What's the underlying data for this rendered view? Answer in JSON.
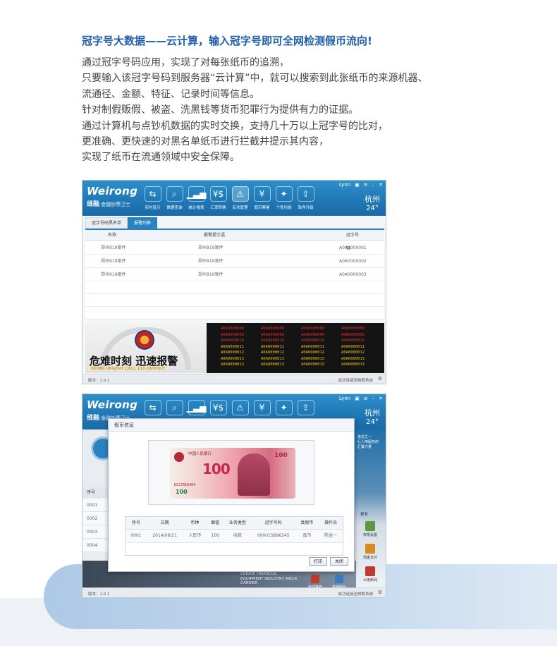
{
  "headline": "冠字号大数据——云计算，输入冠字号即可全网检测假币流向!",
  "body_lines": [
    "通过冠字号码应用，实现了对每张纸币的追溯，",
    "只要输入该冠字号码到服务器“云计算”中，就可以搜索到此张纸币的来源机器、",
    "流通径、金额、特征、记录时间等信息。",
    "针对制假贩假、被盗、洗黑钱等货币犯罪行为提供有力的证据。",
    "通过计算机与点钞机数据的实时交换，支持几十万以上冠字号的比对，",
    "更准确、更快速的对黑名单纸币进行拦截并提示其内容，",
    "实现了纸币在流通领域中安全保障。"
  ],
  "app": {
    "logo": "Weirong",
    "logo_brand": "维融",
    "logo_sub": "·金融钞票卫士",
    "user": "Lynn",
    "city": "杭州",
    "temperature": "24°",
    "version": "版本：1.0.1",
    "connection": "成功连接至物联系统",
    "toolbar": [
      {
        "label": "实时显示",
        "icon": "monitor-icon",
        "glyph": "⇆"
      },
      {
        "label": "数据查询",
        "icon": "search-icon",
        "glyph": "⌕"
      },
      {
        "label": "统计报表",
        "icon": "chart-icon",
        "glyph": "▁▃▅"
      },
      {
        "label": "汇率转换",
        "icon": "exchange-icon",
        "glyph": "¥$"
      },
      {
        "label": "反洗管理",
        "icon": "alert-icon",
        "glyph": "⚠"
      },
      {
        "label": "假币票鉴",
        "icon": "note-icon",
        "glyph": "¥"
      },
      {
        "label": "个性功能",
        "icon": "tools-icon",
        "glyph": "✦"
      },
      {
        "label": "软件升级",
        "icon": "upgrade-icon",
        "glyph": "⇪"
      }
    ]
  },
  "window1": {
    "tabs": [
      "冠字号码黑名单",
      "报警列表"
    ],
    "active_tab": 1,
    "columns": [
      "名称",
      "报警提示语",
      "冠字号"
    ],
    "rows": [
      [
        "郑州919案件",
        "郑州919案件",
        "A0A0000001"
      ],
      [
        "郑州919案件",
        "郑州919案件",
        "A0A0000002"
      ],
      [
        "郑州919案件",
        "郑州919案件",
        "A0A0000003"
      ]
    ],
    "banner_text": "危难时刻  迅速报警",
    "banner_sub": "BEING URGENT CALL 110 QUICKLY",
    "serial_rows": [
      {
        "color": "#e03030",
        "values": [
          "A0A0000008",
          "A0A0000008",
          "A0A0000008",
          "A0A0000008"
        ]
      },
      {
        "color": "#e03030",
        "values": [
          "A0A0000009",
          "A0A0000009",
          "A0A0000009",
          "A0A0000009"
        ]
      },
      {
        "color": "#e03030",
        "values": [
          "A0A0000010",
          "A0A0000010",
          "A0A0000010",
          "A0A0000010"
        ]
      },
      {
        "color": "#f0c020",
        "values": [
          "A0A0000011",
          "A0A0000011",
          "A0A0000011",
          "A0A0000011"
        ]
      },
      {
        "color": "#f0c020",
        "values": [
          "A0A0000012",
          "A0A0000012",
          "A0A0000012",
          "A0A0000012"
        ]
      },
      {
        "color": "#f0c020",
        "values": [
          "A0A0000013",
          "A0A0000013",
          "A0A0000013",
          "A0A0000013"
        ]
      },
      {
        "color": "#f0c020",
        "values": [
          "A0A0000013",
          "A0A0000013",
          "A0A0000013",
          "A0A0000013"
        ]
      }
    ]
  },
  "window2": {
    "left_column_header": "序号",
    "left_rows": [
      "0001",
      "0002",
      "0003",
      "0004"
    ],
    "promo": [
      "单位之一",
      "行人用服务的",
      "汇聚力量"
    ],
    "more": "更多",
    "side_items": [
      "权限设置",
      "现金支付",
      "公用新闻"
    ],
    "carrier_lines": [
      "CREATE FINANCIAL",
      "EQUIPMENT INDUSTRY AIRCR",
      "CARRIER"
    ],
    "news_links": [
      "新闻推荐",
      "常用网址"
    ],
    "dialog": {
      "title": "假币信息",
      "note_bank": "中国人民银行",
      "note_denom": "100",
      "note_value": "100",
      "note_serial": "KC27858404",
      "note_small": "100",
      "columns": [
        "序号",
        "日期",
        "币种",
        "面值",
        "业务类型",
        "冠字号码",
        "真假币",
        "操作员"
      ],
      "row": [
        "0001",
        "2014/08/21",
        "人民币",
        "100",
        "收款",
        "000015896345",
        "真币",
        "陈金一"
      ],
      "print_label": "打印",
      "close_label": "关闭"
    }
  },
  "colors": {
    "accent": "#1f5ea8",
    "header": "#2079b6",
    "tab_active": "#2b82c0"
  }
}
